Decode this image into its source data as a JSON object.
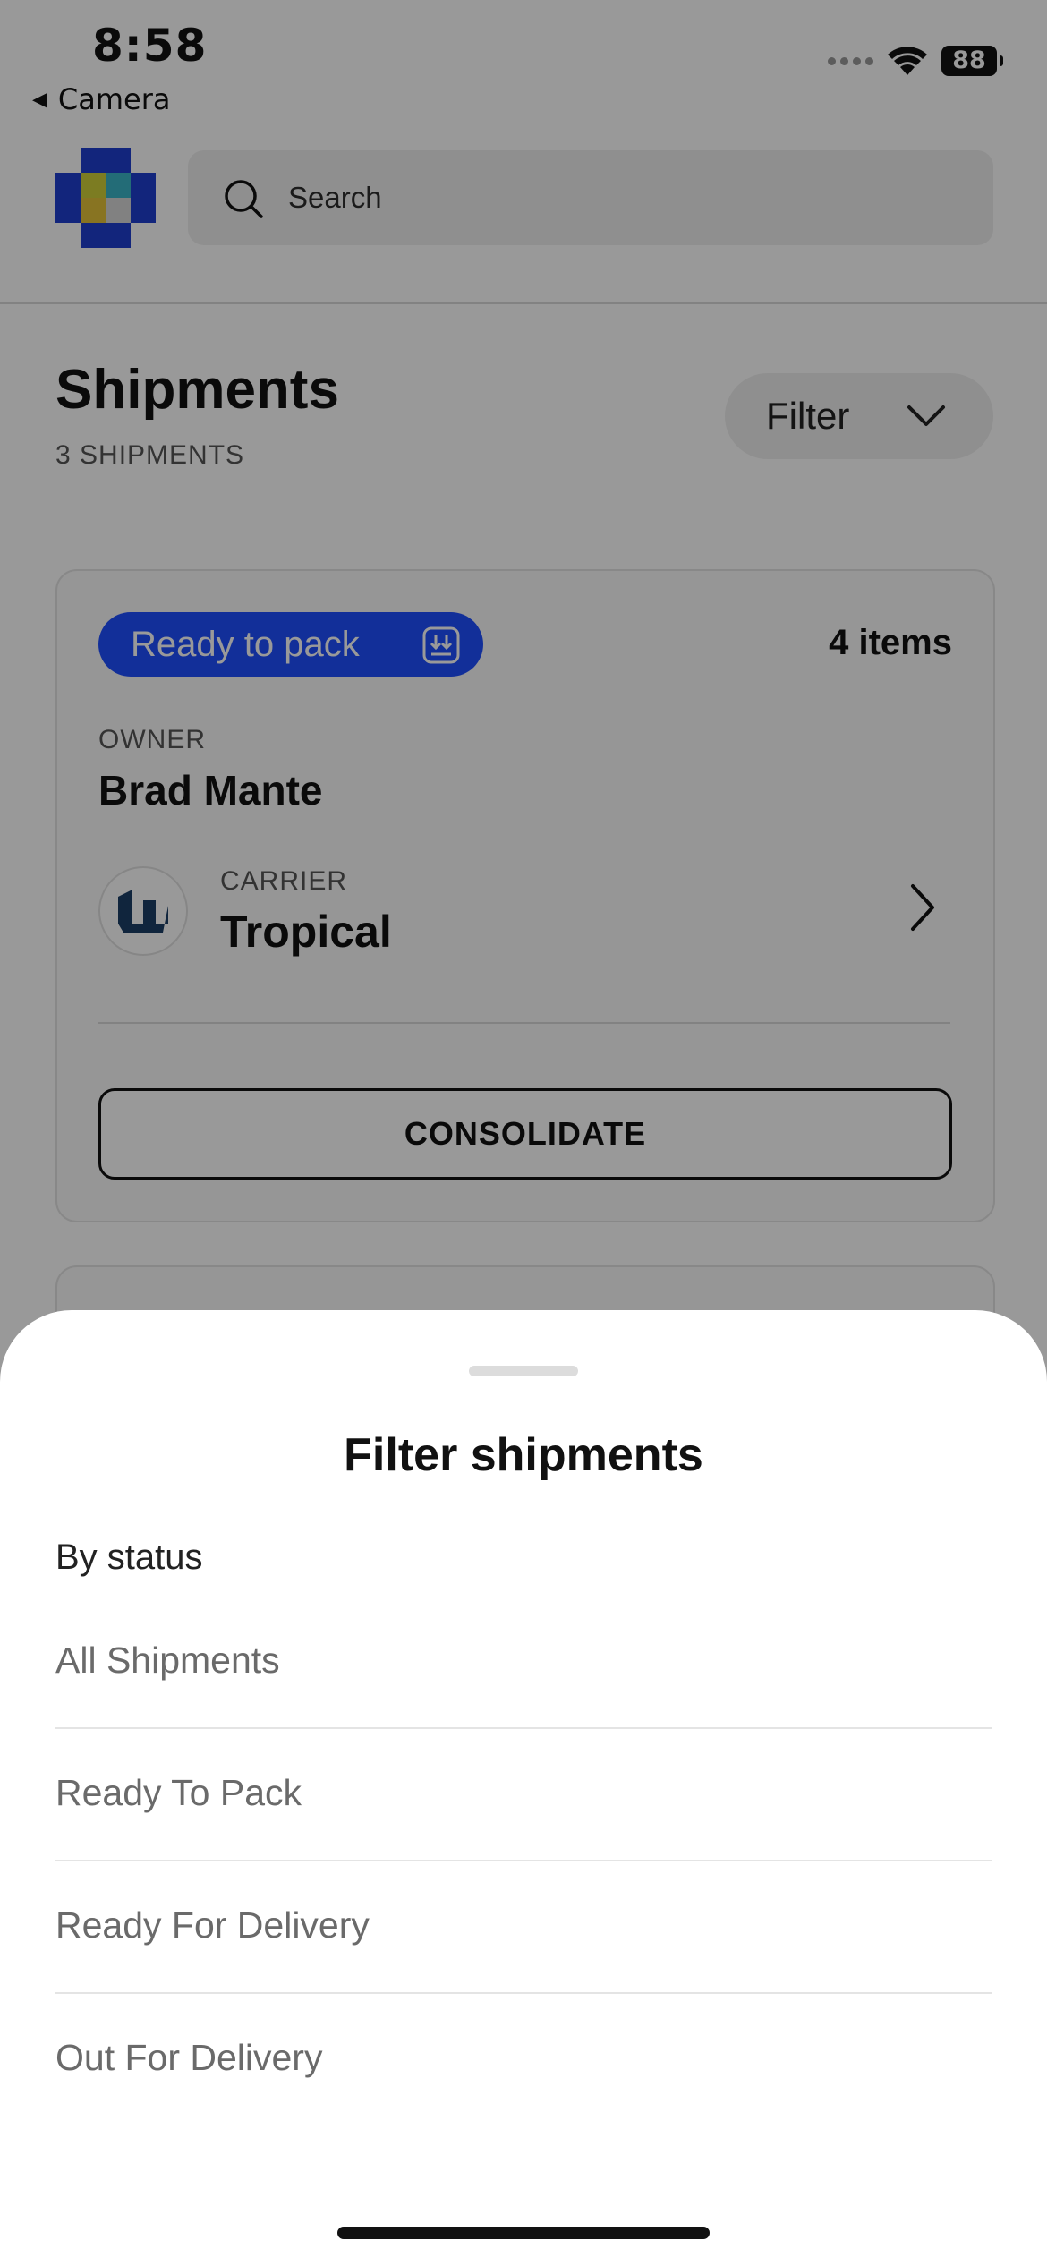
{
  "status_bar": {
    "time": "8:58",
    "back_label": "Camera",
    "battery": "88"
  },
  "header": {
    "search_placeholder": "Search"
  },
  "page": {
    "title": "Shipments",
    "subtitle": "3 SHIPMENTS",
    "filter_label": "Filter"
  },
  "shipment_card": {
    "status": "Ready to pack",
    "items": "4 items",
    "owner_label": "OWNER",
    "owner_name": "Brad Mante",
    "carrier_label": "CARRIER",
    "carrier_name": "Tropical",
    "consolidate_label": "CONSOLIDATE"
  },
  "filter_sheet": {
    "title": "Filter shipments",
    "section_label": "By status",
    "options": [
      {
        "label": "All Shipments"
      },
      {
        "label": "Ready To Pack"
      },
      {
        "label": "Ready For Delivery"
      },
      {
        "label": "Out For Delivery"
      }
    ]
  },
  "colors": {
    "accent": "#1f4fff",
    "overlay": "rgba(0,0,0,0.40)"
  }
}
